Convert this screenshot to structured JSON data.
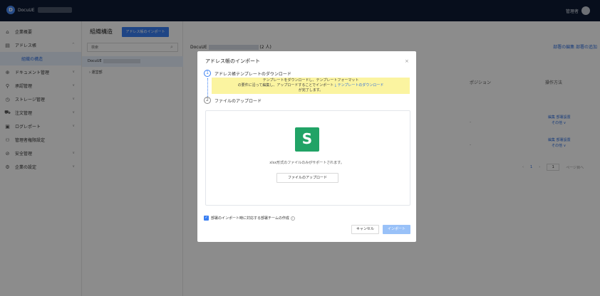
{
  "brand": {
    "name": "DocuUE"
  },
  "header": {
    "admin_label": "管理者"
  },
  "sidebar": {
    "items": [
      {
        "icon": "home-icon",
        "glyph": "⌂",
        "label": "企業概要"
      },
      {
        "icon": "book-icon",
        "glyph": "▤",
        "label": "アドレス帳",
        "chevron": "^"
      },
      {
        "sub": true,
        "label": "組織の構造"
      },
      {
        "icon": "document-icon",
        "glyph": "⊕",
        "label": "ドキュメント管理",
        "chevron": "∨"
      },
      {
        "icon": "user-icon",
        "glyph": "⚲",
        "label": "承認管理",
        "chevron": "∨"
      },
      {
        "icon": "storage-icon",
        "glyph": "◷",
        "label": "ストレージ管理",
        "chevron": "∨"
      },
      {
        "icon": "cart-icon",
        "glyph": "⛟",
        "label": "注文管理",
        "chevron": "∨"
      },
      {
        "icon": "log-icon",
        "glyph": "▣",
        "label": "ログレポート",
        "chevron": "∨"
      },
      {
        "icon": "admin-icon",
        "glyph": "⚇",
        "label": "管理者権限設定"
      },
      {
        "icon": "shield-icon",
        "glyph": "⊘",
        "label": "安全管理",
        "chevron": "∨"
      },
      {
        "icon": "settings-icon",
        "glyph": "⚙",
        "label": "企業の設定",
        "chevron": "∨"
      }
    ]
  },
  "panel": {
    "title": "組織構造",
    "import_button": "アドレス帳のインポート",
    "search_placeholder": "検索",
    "tree": {
      "root": "DocuUE",
      "child": "運営部"
    }
  },
  "main": {
    "header": "DocuUE",
    "count": "(2 人)",
    "links": "部署の編集 部署の追加",
    "columns": [
      "ポジション",
      "操作方法"
    ],
    "rows": [
      {
        "position": "-",
        "actions": [
          "編集 部署設置",
          "その他 ∨"
        ]
      },
      {
        "position": "-",
        "actions": [
          "編集 部署設置",
          "その他 ∨"
        ]
      }
    ],
    "pager": {
      "prev": "‹",
      "page": "1",
      "next": "›",
      "goto_value": "1",
      "suffix": "ページ目へ"
    }
  },
  "modal": {
    "title": "アドレス帳のインポート",
    "close": "×",
    "step1": {
      "num": "1",
      "label": "アドレス帳テンプレートのダウンロード"
    },
    "hint": {
      "line1": "テンプレートをダウンロードし、テンプレートフォーマット",
      "line2": "の要件に沿って編集し、アップロードすることでインポート",
      "link": "テンプレートのダウンロード",
      "line3": "が完了します。"
    },
    "step2": {
      "num": "2",
      "label": "ファイルのアップロード"
    },
    "file_glyph": "S",
    "support_text": "xlsx形式のファイルのみがサポートされます。",
    "upload_button": "ファイルのアップロード",
    "checkbox_label": "部署のインポート時に対応する部署チームの作成",
    "cancel": "キャンセル",
    "import": "インポート"
  }
}
